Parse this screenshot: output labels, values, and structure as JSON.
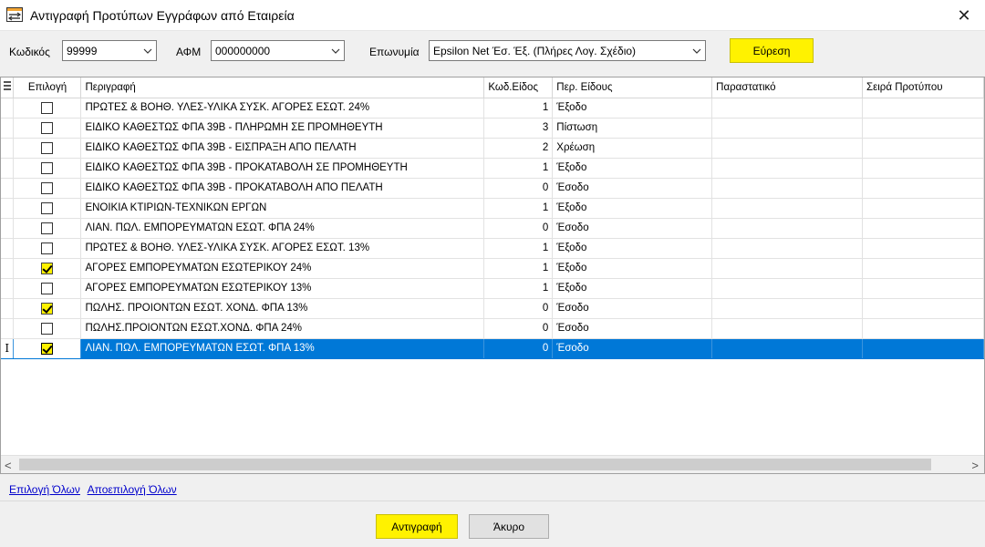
{
  "window": {
    "title": "Αντιγραφή Προτύπων Εγγράφων από Εταιρεία",
    "close_symbol": "✕"
  },
  "search": {
    "code_label": "Κωδικός",
    "code_value": "99999",
    "afm_label": "ΑΦΜ",
    "afm_value": "000000000",
    "name_label": "Επωνυμία",
    "name_value": "Epsilon Net Έσ. Έξ. (Πλήρες Λογ. Σχέδιο)",
    "find_button": "Εύρεση"
  },
  "grid": {
    "columns": [
      "Επιλογή",
      "Περιγραφή",
      "Κωδ.Είδος",
      "Περ. Είδους",
      "Παραστατικό",
      "Σειρά Προτύπου"
    ],
    "rows": [
      {
        "checked": false,
        "desc": "ΠΡΩΤΕΣ & ΒΟΗΘ. ΥΛΕΣ-ΥΛΙΚΑ ΣΥΣΚ. ΑΓΟΡΕΣ ΕΣΩΤ. 24%",
        "code": "1",
        "type": "Έξοδο"
      },
      {
        "checked": false,
        "desc": "ΕΙΔΙΚΟ ΚΑΘΕΣΤΩΣ ΦΠΑ 39Β - ΠΛΗΡΩΜΗ ΣΕ ΠΡΟΜΗΘΕΥΤΗ",
        "code": "3",
        "type": "Πίστωση"
      },
      {
        "checked": false,
        "desc": "ΕΙΔΙΚΟ ΚΑΘΕΣΤΩΣ ΦΠΑ 39Β - ΕΙΣΠΡΑΞΗ ΑΠΟ ΠΕΛΑΤΗ",
        "code": "2",
        "type": "Χρέωση"
      },
      {
        "checked": false,
        "desc": "ΕΙΔΙΚΟ ΚΑΘΕΣΤΩΣ ΦΠΑ 39Β - ΠΡΟΚΑΤΑΒΟΛΗ ΣΕ ΠΡΟΜΗΘΕΥΤΗ",
        "code": "1",
        "type": "Έξοδο"
      },
      {
        "checked": false,
        "desc": "ΕΙΔΙΚΟ ΚΑΘΕΣΤΩΣ ΦΠΑ 39Β - ΠΡΟΚΑΤΑΒΟΛΗ ΑΠΟ ΠΕΛΑΤΗ",
        "code": "0",
        "type": "Έσοδο"
      },
      {
        "checked": false,
        "desc": "ΕΝΟΙΚΙΑ ΚΤΙΡΙΩΝ-ΤΕΧΝΙΚΩΝ ΕΡΓΩΝ",
        "code": "1",
        "type": "Έξοδο"
      },
      {
        "checked": false,
        "desc": "ΛΙΑΝ. ΠΩΛ. ΕΜΠΟΡΕΥΜΑΤΩΝ ΕΣΩΤ. ΦΠΑ 24%",
        "code": "0",
        "type": "Έσοδο"
      },
      {
        "checked": false,
        "desc": "ΠΡΩΤΕΣ & ΒΟΗΘ. ΥΛΕΣ-ΥΛΙΚΑ ΣΥΣΚ. ΑΓΟΡΕΣ ΕΣΩΤ. 13%",
        "code": "1",
        "type": "Έξοδο"
      },
      {
        "checked": true,
        "desc": "ΑΓΟΡΕΣ ΕΜΠΟΡΕΥΜΑΤΩΝ ΕΣΩΤΕΡΙΚΟΥ 24%",
        "code": "1",
        "type": "Έξοδο"
      },
      {
        "checked": false,
        "desc": "ΑΓΟΡΕΣ ΕΜΠΟΡΕΥΜΑΤΩΝ ΕΣΩΤΕΡΙΚΟΥ 13%",
        "code": "1",
        "type": "Έξοδο"
      },
      {
        "checked": true,
        "desc": "ΠΩΛΗΣ. ΠΡΟΙΟΝΤΩΝ ΕΣΩΤ. ΧΟΝΔ. ΦΠΑ 13%",
        "code": "0",
        "type": "Έσοδο"
      },
      {
        "checked": false,
        "desc": "ΠΩΛΗΣ.ΠΡΟΙΟΝΤΩΝ ΕΣΩΤ.ΧΟΝΔ. ΦΠΑ 24%",
        "code": "0",
        "type": "Έσοδο"
      },
      {
        "checked": true,
        "desc": "ΛΙΑΝ. ΠΩΛ. ΕΜΠΟΡΕΥΜΑΤΩΝ ΕΣΩΤ. ΦΠΑ 13%",
        "code": "0",
        "type": "Έσοδο",
        "selected": true
      }
    ]
  },
  "links": {
    "select_all": "Επιλογή Όλων",
    "deselect_all": "Αποεπιλογή Όλων"
  },
  "buttons": {
    "copy": "Αντιγραφή",
    "cancel": "Άκυρο"
  },
  "colors": {
    "highlight": "#fff200",
    "selection": "#0078d7",
    "link": "#0000cc"
  },
  "icons": [
    "app-icon",
    "close-icon",
    "chevron-down-icon",
    "grid-menu-icon",
    "text-cursor-icon",
    "scroll-left-icon",
    "scroll-right-icon"
  ]
}
